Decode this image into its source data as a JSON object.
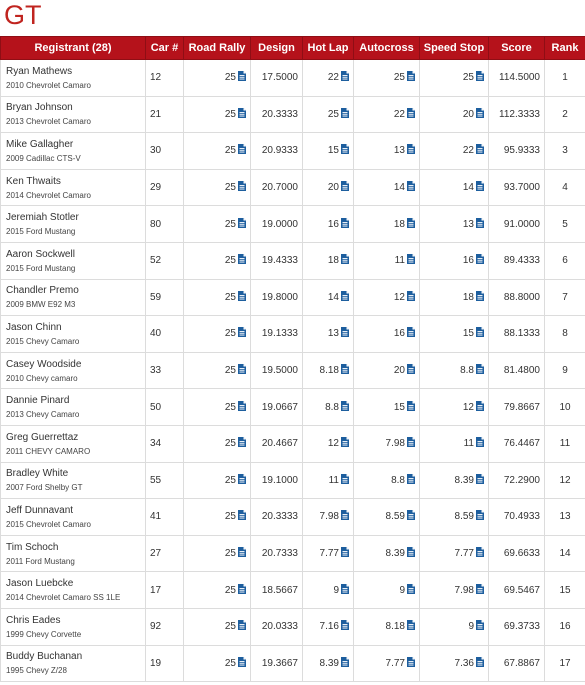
{
  "page": {
    "title": "GT"
  },
  "columns": {
    "registrant": "Registrant (28)",
    "car": "Car #",
    "road_rally": "Road Rally",
    "design": "Design",
    "hot_lap": "Hot Lap",
    "autocross": "Autocross",
    "speed_stop": "Speed Stop",
    "score": "Score",
    "rank": "Rank"
  },
  "icons": {
    "score_detail": "document-icon"
  },
  "colors": {
    "header_bg": "#b5121b",
    "title": "#c0241f",
    "icon": "#1d5e9e"
  },
  "rows": [
    {
      "name": "Ryan Mathews",
      "vehicle": "2010 Chevrolet Camaro",
      "car": "12",
      "road_rally": "25",
      "design": "17.5000",
      "hot_lap": "22",
      "autocross": "25",
      "speed_stop": "25",
      "score": "114.5000",
      "rank": "1"
    },
    {
      "name": "Bryan Johnson",
      "vehicle": "2013 Chevrolet Camaro",
      "car": "21",
      "road_rally": "25",
      "design": "20.3333",
      "hot_lap": "25",
      "autocross": "22",
      "speed_stop": "20",
      "score": "112.3333",
      "rank": "2"
    },
    {
      "name": "Mike Gallagher",
      "vehicle": "2009 Cadillac CTS-V",
      "car": "30",
      "road_rally": "25",
      "design": "20.9333",
      "hot_lap": "15",
      "autocross": "13",
      "speed_stop": "22",
      "score": "95.9333",
      "rank": "3"
    },
    {
      "name": "Ken Thwaits",
      "vehicle": "2014 Chevrolet Camaro",
      "car": "29",
      "road_rally": "25",
      "design": "20.7000",
      "hot_lap": "20",
      "autocross": "14",
      "speed_stop": "14",
      "score": "93.7000",
      "rank": "4"
    },
    {
      "name": "Jeremiah Stotler",
      "vehicle": "2015 Ford Mustang",
      "car": "80",
      "road_rally": "25",
      "design": "19.0000",
      "hot_lap": "16",
      "autocross": "18",
      "speed_stop": "13",
      "score": "91.0000",
      "rank": "5"
    },
    {
      "name": "Aaron Sockwell",
      "vehicle": "2015 Ford Mustang",
      "car": "52",
      "road_rally": "25",
      "design": "19.4333",
      "hot_lap": "18",
      "autocross": "11",
      "speed_stop": "16",
      "score": "89.4333",
      "rank": "6"
    },
    {
      "name": "Chandler Premo",
      "vehicle": "2009 BMW E92 M3",
      "car": "59",
      "road_rally": "25",
      "design": "19.8000",
      "hot_lap": "14",
      "autocross": "12",
      "speed_stop": "18",
      "score": "88.8000",
      "rank": "7"
    },
    {
      "name": "Jason Chinn",
      "vehicle": "2015 Chevy Camaro",
      "car": "40",
      "road_rally": "25",
      "design": "19.1333",
      "hot_lap": "13",
      "autocross": "16",
      "speed_stop": "15",
      "score": "88.1333",
      "rank": "8"
    },
    {
      "name": "Casey Woodside",
      "vehicle": "2010 Chevy camaro",
      "car": "33",
      "road_rally": "25",
      "design": "19.5000",
      "hot_lap": "8.18",
      "autocross": "20",
      "speed_stop": "8.8",
      "score": "81.4800",
      "rank": "9"
    },
    {
      "name": "Dannie Pinard",
      "vehicle": "2013 Chevy Camaro",
      "car": "50",
      "road_rally": "25",
      "design": "19.0667",
      "hot_lap": "8.8",
      "autocross": "15",
      "speed_stop": "12",
      "score": "79.8667",
      "rank": "10"
    },
    {
      "name": "Greg Guerrettaz",
      "vehicle": "2011 CHEVY CAMARO",
      "car": "34",
      "road_rally": "25",
      "design": "20.4667",
      "hot_lap": "12",
      "autocross": "7.98",
      "speed_stop": "11",
      "score": "76.4467",
      "rank": "11"
    },
    {
      "name": "Bradley White",
      "vehicle": "2007 Ford Shelby GT",
      "car": "55",
      "road_rally": "25",
      "design": "19.1000",
      "hot_lap": "11",
      "autocross": "8.8",
      "speed_stop": "8.39",
      "score": "72.2900",
      "rank": "12"
    },
    {
      "name": "Jeff Dunnavant",
      "vehicle": "2015 Chevrolet Camaro",
      "car": "41",
      "road_rally": "25",
      "design": "20.3333",
      "hot_lap": "7.98",
      "autocross": "8.59",
      "speed_stop": "8.59",
      "score": "70.4933",
      "rank": "13"
    },
    {
      "name": "Tim Schoch",
      "vehicle": "2011 Ford Mustang",
      "car": "27",
      "road_rally": "25",
      "design": "20.7333",
      "hot_lap": "7.77",
      "autocross": "8.39",
      "speed_stop": "7.77",
      "score": "69.6633",
      "rank": "14"
    },
    {
      "name": "Jason Luebcke",
      "vehicle": "2014 Chevrolet Camaro SS 1LE",
      "car": "17",
      "road_rally": "25",
      "design": "18.5667",
      "hot_lap": "9",
      "autocross": "9",
      "speed_stop": "7.98",
      "score": "69.5467",
      "rank": "15"
    },
    {
      "name": "Chris Eades",
      "vehicle": "1999 Chevy Corvette",
      "car": "92",
      "road_rally": "25",
      "design": "20.0333",
      "hot_lap": "7.16",
      "autocross": "8.18",
      "speed_stop": "9",
      "score": "69.3733",
      "rank": "16"
    },
    {
      "name": "Buddy Buchanan",
      "vehicle": "1995 Chevy Z/28",
      "car": "19",
      "road_rally": "25",
      "design": "19.3667",
      "hot_lap": "8.39",
      "autocross": "7.77",
      "speed_stop": "7.36",
      "score": "67.8867",
      "rank": "17"
    }
  ]
}
